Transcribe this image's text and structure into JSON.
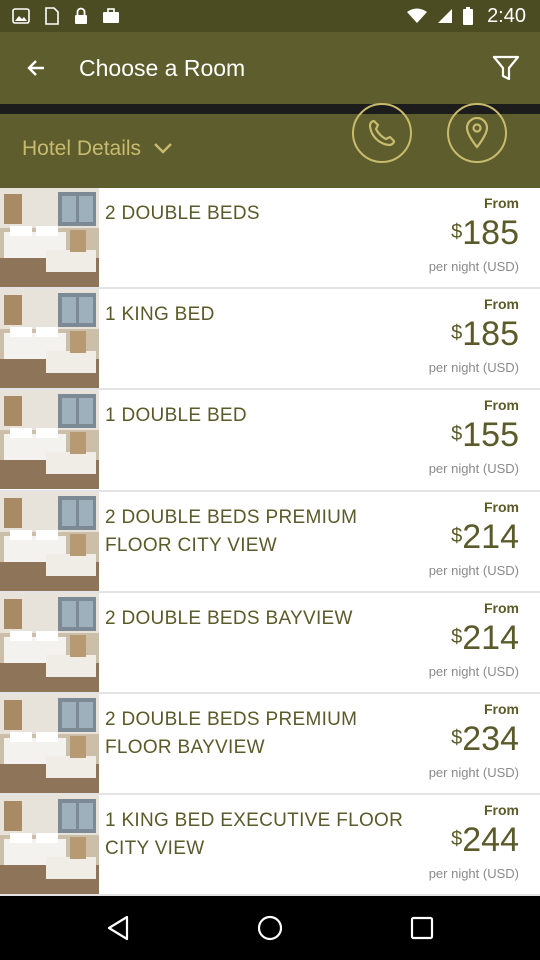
{
  "status_bar": {
    "time": "2:40"
  },
  "app_bar": {
    "title": "Choose a Room"
  },
  "details": {
    "label": "Hotel Details"
  },
  "rooms": [
    {
      "name": "2 DOUBLE BEDS",
      "from": "From",
      "currency": "$",
      "price": "185",
      "unit": "per night (USD)"
    },
    {
      "name": "1 KING BED",
      "from": "From",
      "currency": "$",
      "price": "185",
      "unit": "per night (USD)"
    },
    {
      "name": "1 DOUBLE BED",
      "from": "From",
      "currency": "$",
      "price": "155",
      "unit": "per night (USD)"
    },
    {
      "name": "2 DOUBLE BEDS PREMIUM FLOOR CITY VIEW",
      "from": "From",
      "currency": "$",
      "price": "214",
      "unit": "per night (USD)"
    },
    {
      "name": "2 DOUBLE BEDS BAYVIEW",
      "from": "From",
      "currency": "$",
      "price": "214",
      "unit": "per night (USD)"
    },
    {
      "name": "2 DOUBLE BEDS PREMIUM FLOOR BAYVIEW",
      "from": "From",
      "currency": "$",
      "price": "234",
      "unit": "per night (USD)"
    },
    {
      "name": "1 KING BED EXECUTIVE FLOOR CITY VIEW",
      "from": "From",
      "currency": "$",
      "price": "244",
      "unit": "per night (USD)"
    }
  ],
  "icons": {
    "back": "arrow-back-icon",
    "filter": "filter-icon",
    "call": "phone-icon",
    "map": "map-pin-icon",
    "nav_back": "nav-back-icon",
    "nav_home": "nav-home-icon",
    "nav_recents": "nav-recents-icon"
  },
  "colors": {
    "app_bar": "#5e5d2d",
    "status_bar": "#4c4c23",
    "accent_gold": "#c8bb6e",
    "text_olive": "#5b5a2a",
    "divider": "#e3e3e3"
  }
}
